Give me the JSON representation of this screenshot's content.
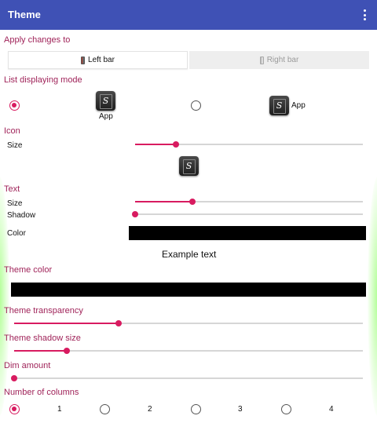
{
  "header": {
    "title": "Theme",
    "menu_icon": "more-vert-icon"
  },
  "apply_changes": {
    "heading": "Apply changes to",
    "options": [
      {
        "label": "Left bar",
        "icon": "phone-icon",
        "selected": true
      },
      {
        "label": "Right bar",
        "icon": "phone-icon",
        "selected": false
      }
    ]
  },
  "list_mode": {
    "heading": "List displaying mode",
    "options": [
      {
        "label": "App",
        "icon": "app-icon",
        "icon_glyph": "S",
        "selected": true
      },
      {
        "label": "App",
        "icon": "app-icon",
        "icon_glyph": "S",
        "selected": false
      }
    ]
  },
  "icon_section": {
    "heading": "Icon",
    "size_label": "Size",
    "size_value": 0.18,
    "preview_glyph": "S"
  },
  "text_section": {
    "heading": "Text",
    "size_label": "Size",
    "size_value": 0.25,
    "shadow_label": "Shadow",
    "shadow_value": 0.0,
    "color_label": "Color",
    "color": "#000000",
    "example_text": "Example text"
  },
  "theme_color": {
    "heading": "Theme color",
    "color": "#000000"
  },
  "theme_transparency": {
    "heading": "Theme transparency",
    "value": 0.3
  },
  "theme_shadow_size": {
    "heading": "Theme shadow size",
    "value": 0.15
  },
  "dim_amount": {
    "heading": "Dim amount",
    "value": 0.0
  },
  "columns": {
    "heading": "Number of columns",
    "options": [
      {
        "label": "1",
        "selected": true
      },
      {
        "label": "2",
        "selected": false
      },
      {
        "label": "3",
        "selected": false
      },
      {
        "label": "4",
        "selected": false
      }
    ]
  },
  "colors": {
    "appbar": "#3f51b5",
    "accent": "#d81b60",
    "heading": "#a0245a"
  }
}
